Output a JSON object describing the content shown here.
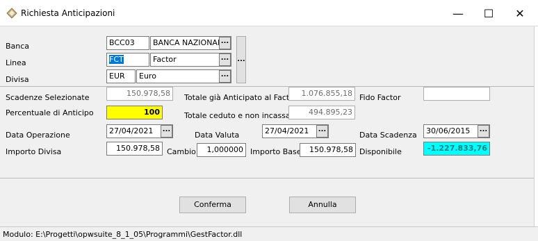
{
  "window": {
    "title": "Richiesta Anticipazioni",
    "minimize_glyph": "—",
    "maximize_glyph": "☐",
    "close_glyph": "✕"
  },
  "banca": {
    "label": "Banca",
    "code": "BCC03",
    "name": "BANCA NAZIONALE"
  },
  "linea": {
    "label": "Linea",
    "code": "FCT",
    "name": "Factor"
  },
  "divisa": {
    "label": "Divisa",
    "code": "EUR",
    "name": "Euro"
  },
  "lookup_glyph": "...",
  "scadenze": {
    "label": "Scadenze Selezionate",
    "value": "150.978,58"
  },
  "totale_anticipato": {
    "label": "Totale già Anticipato al Factor",
    "value": "1.076.855,18"
  },
  "fido_factor": {
    "label": "Fido Factor",
    "value": ""
  },
  "percentuale": {
    "label": "Percentuale di Anticipo",
    "value": "100"
  },
  "totale_ceduto": {
    "label": "Totale ceduto e non incassato",
    "value": "494.895,23"
  },
  "data_operazione": {
    "label": "Data Operazione",
    "value": "27/04/2021"
  },
  "data_valuta": {
    "label": "Data Valuta",
    "value": "27/04/2021"
  },
  "data_scadenza": {
    "label": "Data Scadenza",
    "value": "30/06/2015"
  },
  "importo_divisa": {
    "label": "Importo Divisa",
    "value": "150.978,58"
  },
  "cambio": {
    "label": "Cambio",
    "value": "1,000000"
  },
  "importo_base": {
    "label": "Importo Base",
    "value": "150.978,58"
  },
  "disponibile": {
    "label": "Disponibile",
    "value": "-1.227.833,76"
  },
  "buttons": {
    "confirm": "Conferma",
    "cancel": "Annulla"
  },
  "status": {
    "text": "Modulo: E:\\Progetti\\opwsuite_8_1_05\\Programmi\\GestFactor.dll"
  },
  "colors": {
    "percent_bg": "#ffff00",
    "disponibile_bg": "#00ffff",
    "disponibile_text": "#008080",
    "selection": "#0078d7"
  }
}
